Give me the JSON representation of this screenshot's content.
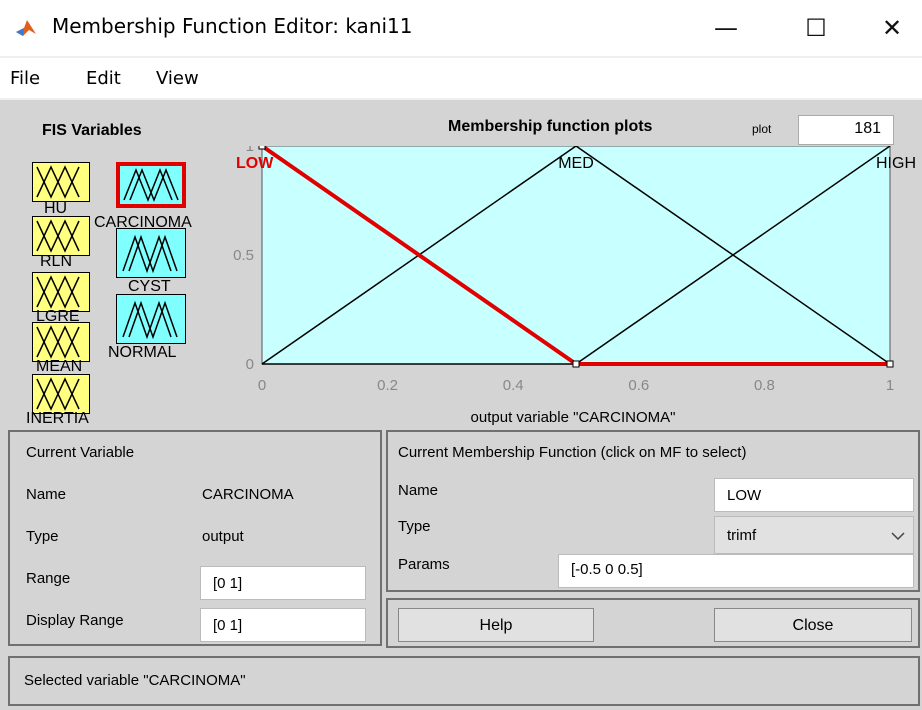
{
  "window": {
    "title": "Membership Function Editor: kani11",
    "minimize_icon": "minimize-icon",
    "maximize_icon": "maximize-icon",
    "close_icon": "close-icon",
    "minimize_glyph": "—",
    "maximize_glyph": "☐",
    "close_glyph": "✕"
  },
  "menu": {
    "file": "File",
    "edit": "Edit",
    "view": "View"
  },
  "fis": {
    "title": "FIS Variables",
    "inputs": [
      "HU",
      "RLN",
      "LGRE",
      "MEAN",
      "INERTIA"
    ],
    "outputs": [
      "CARCINOMA",
      "CYST",
      "NORMAL"
    ],
    "selected": "CARCINOMA",
    "input_color": "#ffff80",
    "output_color": "#80ffff",
    "selected_color": "#e00000"
  },
  "plot": {
    "title": "Membership function plots",
    "points_label": "plot",
    "points_value": "181",
    "xlabel": "output variable \"CARCINOMA\"",
    "background": "#c8ffff"
  },
  "chart_data": {
    "type": "line",
    "title": "Membership function plots",
    "xlabel": "output variable \"CARCINOMA\"",
    "ylabel": "",
    "xlim": [
      0,
      1
    ],
    "ylim": [
      0,
      1
    ],
    "x_ticks": [
      "0",
      "0.2",
      "0.4",
      "0.6",
      "0.8",
      "1"
    ],
    "y_ticks": [
      "0",
      "0.5",
      "1"
    ],
    "series": [
      {
        "name": "LOW",
        "x": [
          0,
          0.5,
          1
        ],
        "y": [
          1,
          0,
          0
        ],
        "color": "#e00000",
        "selected": true
      },
      {
        "name": "MED",
        "x": [
          0,
          0.5,
          1
        ],
        "y": [
          0,
          1,
          0
        ],
        "color": "#000000",
        "selected": false
      },
      {
        "name": "HIGH",
        "x": [
          0,
          0.5,
          1
        ],
        "y": [
          0,
          0,
          1
        ],
        "color": "#000000",
        "selected": false
      }
    ]
  },
  "current_variable": {
    "title": "Current Variable",
    "name_label": "Name",
    "name_value": "CARCINOMA",
    "type_label": "Type",
    "type_value": "output",
    "range_label": "Range",
    "range_value": "[0 1]",
    "display_range_label": "Display Range",
    "display_range_value": "[0 1]"
  },
  "current_mf": {
    "title": "Current Membership Function (click on MF to select)",
    "name_label": "Name",
    "name_value": "LOW",
    "type_label": "Type",
    "type_value": "trimf",
    "params_label": "Params",
    "params_value": "[-0.5 0 0.5]"
  },
  "buttons": {
    "help": "Help",
    "close": "Close"
  },
  "status": "Selected variable \"CARCINOMA\""
}
